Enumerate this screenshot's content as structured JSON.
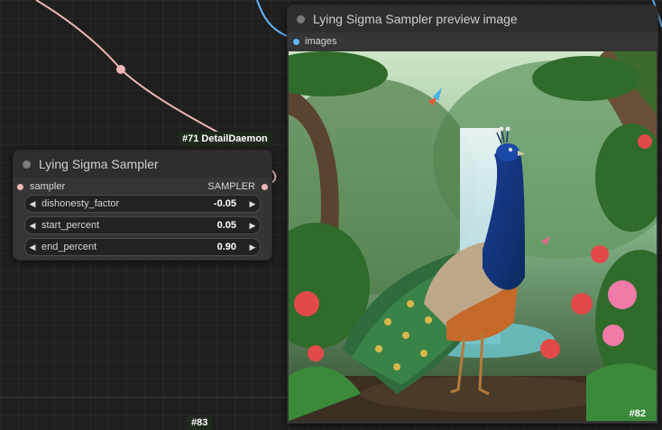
{
  "canvas": {
    "background": "#1f1f1f"
  },
  "badges": {
    "detail_daemon": "#71 DetailDaemon",
    "bottom_cut": "#83"
  },
  "sampler_node": {
    "title": "Lying Sigma Sampler",
    "input_label": "sampler",
    "output_label": "SAMPLER",
    "widgets": [
      {
        "label": "dishonesty_factor",
        "value": "-0.05"
      },
      {
        "label": "start_percent",
        "value": "0.05"
      },
      {
        "label": "end_percent",
        "value": "0.90"
      }
    ]
  },
  "preview_node": {
    "title": "Lying Sigma Sampler preview image",
    "input_label": "images",
    "id": "#82",
    "image_description": "peacock-in-jungle-with-waterfall"
  },
  "colors": {
    "sampler_wire": "#f0b6b6",
    "image_wire": "#64b5f6",
    "node_body": "#353535",
    "node_header": "#2e2e2e"
  },
  "icons": {
    "decrement": "◀",
    "increment": "▶"
  }
}
